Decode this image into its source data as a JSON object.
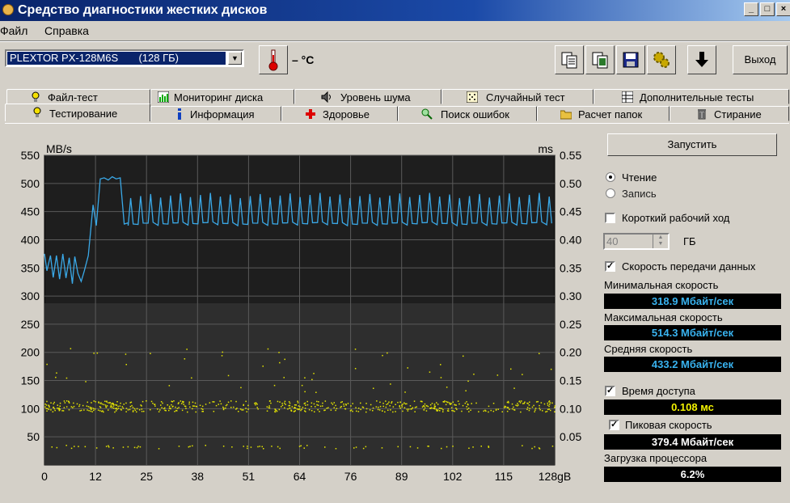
{
  "window": {
    "title": "Средство диагностики жестких дисков"
  },
  "menu": {
    "file": "Файл",
    "help": "Справка"
  },
  "drive": {
    "name": "PLEXTOR PX-128M6S",
    "size": "(128 ГБ)"
  },
  "temperature": {
    "value": "– °C"
  },
  "toolbar": {
    "icons": [
      "copy-icon",
      "copy-screenshot-icon",
      "save-icon",
      "options-icon",
      "download-icon"
    ],
    "exit_label": "Выход"
  },
  "tabs_row1": [
    "Файл-тест",
    "Мониторинг диска",
    "Уровень шума",
    "Случайный тест",
    "Дополнительные тесты"
  ],
  "tabs_row2": [
    "Тестирование",
    "Информация",
    "Здоровье",
    "Поиск ошибок",
    "Расчет папок",
    "Стирание"
  ],
  "side": {
    "start_label": "Запустить",
    "read_label": "Чтение",
    "write_label": "Запись",
    "short_stroke_label": "Короткий рабочий ход",
    "short_stroke_value": "40",
    "short_stroke_unit": "ГБ",
    "transfer_rate_label": "Скорость передачи данных",
    "min_label": "Минимальная скорость",
    "min_value": "318.9 Мбайт/сек",
    "max_label": "Максимальная скорость",
    "max_value": "514.3 Мбайт/сек",
    "avg_label": "Средняя скорость",
    "avg_value": "433.2 Мбайт/сек",
    "access_label": "Время доступа",
    "access_value": "0.108 мс",
    "burst_label": "Пиковая скорость",
    "burst_value": "379.4 Мбайт/сек",
    "cpu_label": "Загрузка процессора",
    "cpu_value": "6.2%"
  },
  "colors": {
    "transfer": "#3aa9e8",
    "access": "#e6e600",
    "value_blue": "#39b3f0",
    "value_yellow": "#f2f200",
    "value_white": "#ffffff"
  },
  "chart_data": {
    "type": "line",
    "left_axis_unit": "MB/s",
    "right_axis_unit": "ms",
    "ylim": [
      0,
      550
    ],
    "y2lim": [
      0,
      0.55
    ],
    "y_ticks": [
      "550",
      "500",
      "450",
      "400",
      "350",
      "300",
      "250",
      "200",
      "150",
      "100",
      "50"
    ],
    "y2_ticks": [
      "0.55",
      "0.50",
      "0.45",
      "0.40",
      "0.35",
      "0.30",
      "0.25",
      "0.20",
      "0.15",
      "0.10",
      "0.05"
    ],
    "x_ticks": [
      "0",
      "12",
      "25",
      "38",
      "51",
      "64",
      "76",
      "89",
      "102",
      "115",
      "128gB"
    ],
    "xlim": [
      0,
      128
    ],
    "series": [
      {
        "name": "transfer",
        "x": [
          0,
          0.6,
          1.5,
          2.2,
          3,
          3.8,
          4.6,
          5.4,
          6.2,
          7,
          7.6,
          8.4,
          9.2,
          10,
          11,
          12.2,
          13,
          14,
          15,
          16,
          17,
          18,
          19,
          20,
          21
        ],
        "y": [
          375,
          345,
          372,
          333,
          372,
          330,
          375,
          332,
          368,
          322,
          370,
          340,
          326,
          345,
          372,
          462,
          425,
          508,
          510,
          506,
          512,
          508,
          510,
          428,
          430
        ]
      },
      {
        "name": "access",
        "type": "scatter"
      }
    ],
    "periodic": {
      "x_start": 21,
      "x_end": 128,
      "period": 2.5,
      "base": 425,
      "peak": 480
    }
  }
}
